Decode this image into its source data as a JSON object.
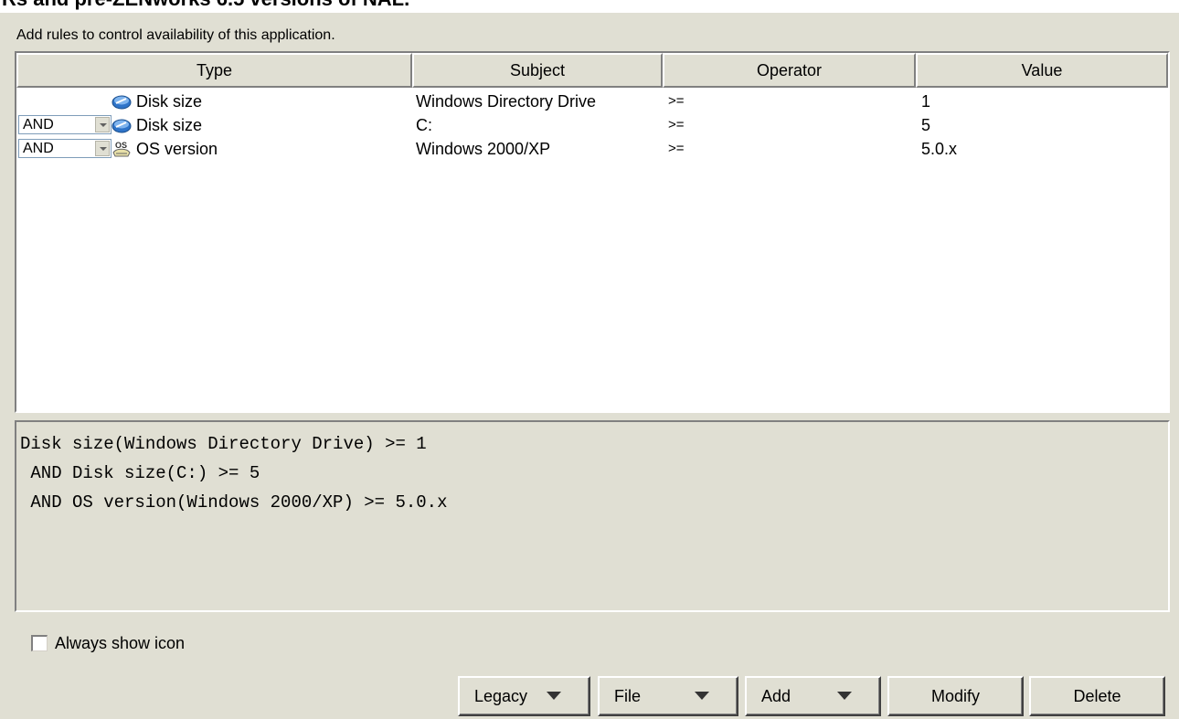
{
  "header": {
    "cut_title": "Rs and pre-ZENworks 6.5 versions of NAL."
  },
  "instruction": "Add rules to control availability of this application.",
  "table": {
    "columns": [
      "Type",
      "Subject",
      "Operator",
      "Value"
    ],
    "rows": [
      {
        "conj": "",
        "type": "Disk size",
        "icon": "disk-icon",
        "subject": "Windows Directory Drive",
        "operator": ">=",
        "value": "1"
      },
      {
        "conj": "AND",
        "type": "Disk size",
        "icon": "disk-icon",
        "subject": "C:",
        "operator": ">=",
        "value": "5"
      },
      {
        "conj": "AND",
        "type": "OS version",
        "icon": "os-icon",
        "subject": "Windows 2000/XP",
        "operator": ">=",
        "value": "5.0.x"
      }
    ]
  },
  "expression": [
    "Disk size(Windows Directory Drive) >= 1",
    " AND Disk size(C:) >= 5",
    " AND OS version(Windows 2000/XP) >= 5.0.x"
  ],
  "always_show_icon": {
    "label": "Always show icon",
    "checked": false
  },
  "buttons": {
    "legacy": "Legacy",
    "file": "File",
    "add": "Add",
    "modify": "Modify",
    "delete": "Delete"
  },
  "colors": {
    "background": "#e0dfd3",
    "table_bg": "#ffffff",
    "disk_icon": "#2f74c9"
  }
}
